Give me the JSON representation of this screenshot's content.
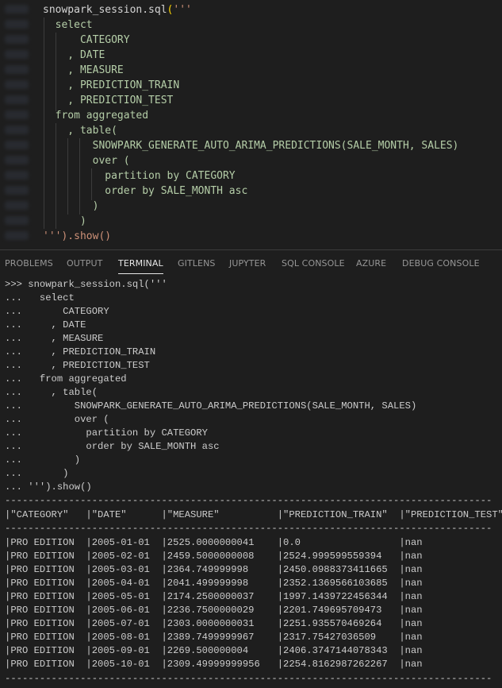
{
  "editor": {
    "lines": [
      "snowpark_session.sql('''",
      "  select",
      "      CATEGORY",
      "    , DATE",
      "    , MEASURE",
      "    , PREDICTION_TRAIN",
      "    , PREDICTION_TEST",
      "  from aggregated",
      "    , table(",
      "        SNOWPARK_GENERATE_AUTO_ARIMA_PREDICTIONS(SALE_MONTH, SALES)",
      "        over (",
      "          partition by CATEGORY",
      "          order by SALE_MONTH asc",
      "        )",
      "      )",
      "''').show()"
    ]
  },
  "panel": {
    "tabs": [
      "PROBLEMS",
      "OUTPUT",
      "TERMINAL",
      "GITLENS",
      "JUPYTER",
      "SQL CONSOLE",
      "AZURE",
      "DEBUG CONSOLE"
    ],
    "active_tab": "TERMINAL"
  },
  "terminal": {
    "lines": [
      ">>> snowpark_session.sql('''",
      "...   select",
      "...       CATEGORY",
      "...     , DATE",
      "...     , MEASURE",
      "...     , PREDICTION_TRAIN",
      "...     , PREDICTION_TEST",
      "...   from aggregated",
      "...     , table(",
      "...         SNOWPARK_GENERATE_AUTO_ARIMA_PREDICTIONS(SALE_MONTH, SALES)",
      "...         over (",
      "...           partition by CATEGORY",
      "...           order by SALE_MONTH asc",
      "...         )",
      "...       )",
      "... ''').show()",
      "------------------------------------------------------------------------------------",
      "|\"CATEGORY\"   |\"DATE\"      |\"MEASURE\"          |\"PREDICTION_TRAIN\"  |\"PREDICTION_TEST\"  |",
      "------------------------------------------------------------------------------------",
      "|PRO EDITION  |2005-01-01  |2525.0000000041    |0.0                 |nan                |",
      "|PRO EDITION  |2005-02-01  |2459.5000000008    |2524.999599559394   |nan                |",
      "|PRO EDITION  |2005-03-01  |2364.749999998     |2450.0988373411665  |nan                |",
      "|PRO EDITION  |2005-04-01  |2041.499999998     |2352.1369566103685  |nan                |",
      "|PRO EDITION  |2005-05-01  |2174.2500000037    |1997.1439722456344  |nan                |",
      "|PRO EDITION  |2005-06-01  |2236.7500000029    |2201.749695709473   |nan                |",
      "|PRO EDITION  |2005-07-01  |2303.0000000031    |2251.935570469264   |nan                |",
      "|PRO EDITION  |2005-08-01  |2389.7499999967    |2317.75427036509    |nan                |",
      "|PRO EDITION  |2005-09-01  |2269.500000004     |2406.3747144078343  |nan                |",
      "|PRO EDITION  |2005-10-01  |2309.49999999956   |2254.8162987262267  |nan                |",
      "------------------------------------------------------------------------------------"
    ]
  }
}
